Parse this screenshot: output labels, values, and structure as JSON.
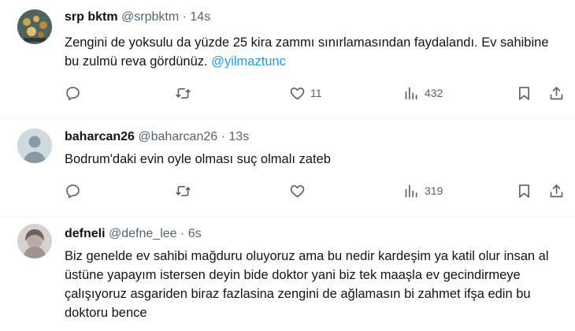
{
  "tweets": [
    {
      "name": "srp bktm",
      "handle": "@srpbktm",
      "time": "14s",
      "text": "Zengini de yoksulu da yüzde 25 kira zammı sınırlamasından faydalandı. Ev sahibine bu zulmü reva gördünüz. ",
      "mention": "@yilmaztunc",
      "likes": "11",
      "views": "432"
    },
    {
      "name": "baharcan26",
      "handle": "@baharcan26",
      "time": "13s",
      "text": "Bodrum'daki evin oyle olması suç olmalı zateb",
      "likes": "",
      "views": "319"
    },
    {
      "name": "defneli",
      "handle": "@defne_lee",
      "time": "6s",
      "text": "Biz genelde ev sahibi mağduru oluyoruz ama bu nedir kardeşim ya katil olur insan al üstüne yapayım istersen deyin bide doktor yani biz tek maaşla ev gecindirmeye çalışıyoruz asgariden biraz fazlasina zengini de ağlamasın bi zahmet ifşa edin bu doktoru bence"
    }
  ],
  "separator": "·",
  "icons": [
    "reply-icon",
    "retweet-icon",
    "like-icon",
    "views-icon",
    "bookmark-icon",
    "share-icon"
  ],
  "colors": {
    "link": "#1d9bf0",
    "muted": "#536471",
    "divider": "#eff3f4"
  }
}
